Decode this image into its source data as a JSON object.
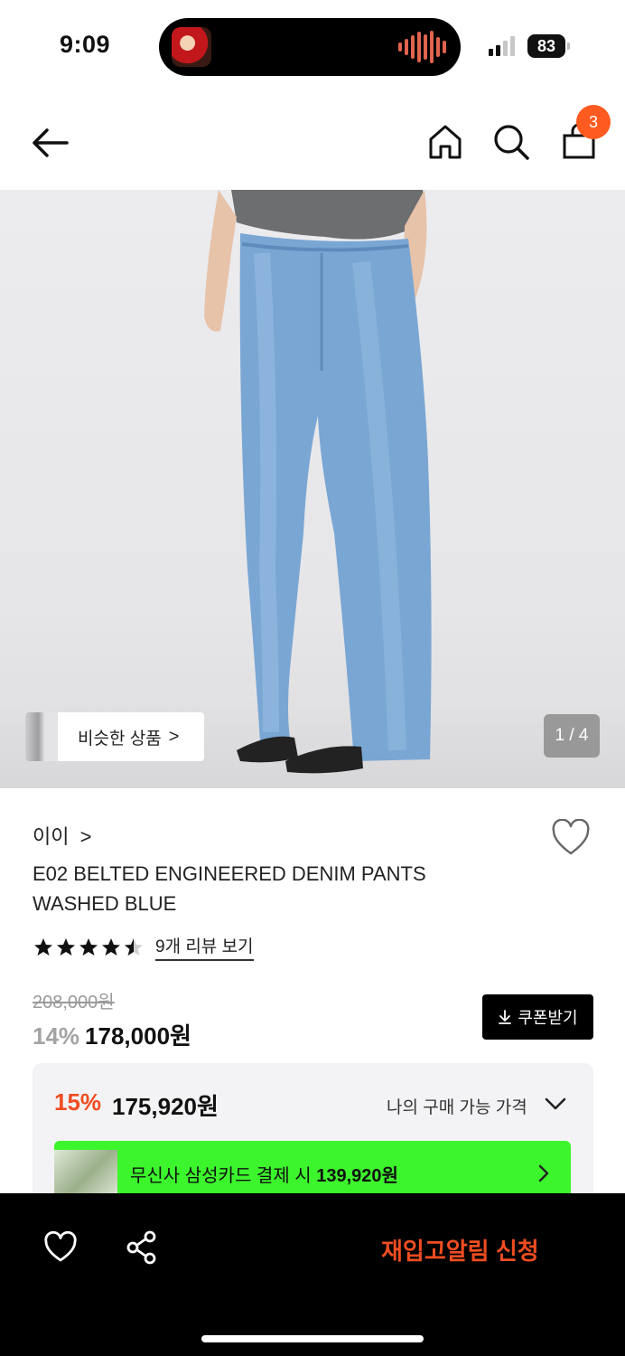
{
  "status_bar": {
    "time": "9:09",
    "battery": "83"
  },
  "header": {
    "cart_count": "3"
  },
  "hero": {
    "similar_label": "비슷한 상품",
    "similar_chevron": ">",
    "pager": "1 / 4"
  },
  "product": {
    "brand": "이이",
    "brand_chevron": ">",
    "title": "E02 BELTED ENGINEERED DENIM PANTS WASHED BLUE",
    "rating": 4.5,
    "review_link": "9개 리뷰 보기",
    "original_price": "208,000원",
    "discount": "14%",
    "price": "178,000원",
    "coupon_label": "쿠폰받기"
  },
  "my_price": {
    "discount": "15%",
    "price": "175,920원",
    "label": "나의 구매 가능 가격"
  },
  "card_promo": {
    "text": "무신사 삼성카드 결제 시",
    "price": "139,920원"
  },
  "bottom_bar": {
    "restock_label": "재입고알림 신청"
  },
  "colors": {
    "accent": "#ef4d21",
    "promo_green": "#3cf52c",
    "badge": "#ff5a1f"
  }
}
